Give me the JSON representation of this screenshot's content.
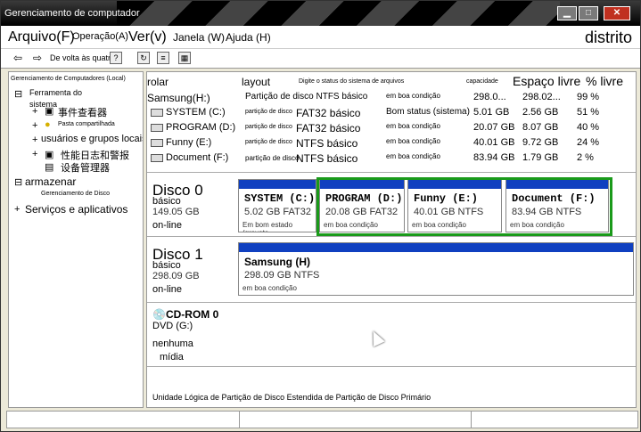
{
  "window": {
    "title": "Gerenciamento de computador",
    "min_label": "▁",
    "max_label": "□",
    "close_label": "✕"
  },
  "menu": {
    "arquivo": "Arquivo(F)",
    "operacao": "Operação(A)",
    "ver": "Ver(v)",
    "janela": "Janela (W)",
    "ajuda": "Ajuda (H)",
    "distrito": "distrito"
  },
  "toolbar": {
    "back_label": "De volta às quatro"
  },
  "tree": {
    "root": "Gerenciamento de Computadores (Local)",
    "tools": "Ferramenta do sistema",
    "event_viewer": "事件查看器",
    "shared": "Pasta compartilhada",
    "users": "usuários e grupos locais",
    "perf": "性能日志和警报",
    "devmgr": "设备管理器",
    "storage": "armazenar",
    "diskmgmt": "Gerenciamento de Disco",
    "services": "Serviços e aplicativos"
  },
  "columns": {
    "volume": "rolar",
    "layout": "layout",
    "type": "Digite o status do sistema de arquivos",
    "capacity": "capacidade",
    "free": "Espaço livre",
    "pct": "% livre"
  },
  "volumes": [
    {
      "name": "Samsung(H:)",
      "layout": "Partição de disco NTFS básico",
      "status": "em boa condição",
      "capacity": "298.0...",
      "free": "298.02...",
      "pct": "99 %"
    },
    {
      "name": "SYSTEM (C:)",
      "layout": "partição de disco",
      "type": "FAT32 básico",
      "status": "Bom status (sistema)",
      "capacity": "5.01 GB",
      "free": "2.56 GB",
      "pct": "51 %"
    },
    {
      "name": "PROGRAM (D:)",
      "layout": "partição de disco",
      "type": "FAT32 básico",
      "status": "em boa condição",
      "capacity": "20.07 GB",
      "free": "8.07 GB",
      "pct": "40 %"
    },
    {
      "name": "Funny (E:)",
      "layout": "partição de disco",
      "type": "NTFS básico",
      "status": "em boa condição",
      "capacity": "40.01 GB",
      "free": "9.72 GB",
      "pct": "24 %"
    },
    {
      "name": "Document (F:)",
      "layout": "partição de disco",
      "type": "NTFS básico",
      "status": "em boa condição",
      "capacity": "83.94 GB",
      "free": "1.79 GB",
      "pct": "2 %"
    }
  ],
  "disk0": {
    "name": "Disco 0",
    "kind": "básico",
    "size": "149.05 GB",
    "state": "on-line",
    "parts": [
      {
        "name": "SYSTEM  (C:)",
        "size": "5.02 GB FAT32",
        "status": "Em bom estado (gravata"
      },
      {
        "name": "PROGRAM  (D:)",
        "size": "20.08 GB FAT32",
        "status": "em boa condição"
      },
      {
        "name": "Funny  (E:)",
        "size": "40.01 GB NTFS",
        "status": "em boa condição"
      },
      {
        "name": "Document  (F:)",
        "size": "83.94 GB NTFS",
        "status": "em boa condição"
      }
    ]
  },
  "disk1": {
    "name": "Disco 1",
    "kind": "básico",
    "size": "298.09 GB",
    "state": "on-line",
    "part": {
      "name": "Samsung (H)",
      "size": "298.09 GB NTFS",
      "status": "em boa condição"
    }
  },
  "cdrom": {
    "name": "CD-ROM 0",
    "drive": "DVD (G:)",
    "state1": "nenhuma",
    "state2": "mídia"
  },
  "legend": "Unidade Lógica de Partição de Disco Estendida de Partição de Disco Primário"
}
